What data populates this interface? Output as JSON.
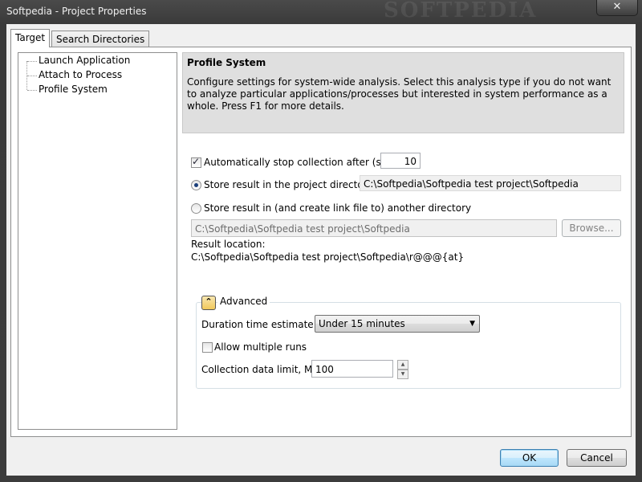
{
  "window": {
    "title": "Softpedia - Project Properties",
    "watermark": "SOFTPEDIA",
    "close_label": "✕"
  },
  "tabs": [
    {
      "label": "Target",
      "active": true
    },
    {
      "label": "Search Directories",
      "active": false
    }
  ],
  "tree": {
    "items": [
      "Launch Application",
      "Attach to Process",
      "Profile System"
    ],
    "selected": "Profile System"
  },
  "panel": {
    "title": "Profile System",
    "description": "Configure settings for system-wide analysis. Select this analysis type if you do not want to analyze particular applications/processes but interested in system performance as a whole. Press F1 for more details."
  },
  "options": {
    "auto_stop_label": "Automatically stop collection after (sec):",
    "auto_stop_checked": true,
    "auto_stop_value": "10",
    "store_project_label": "Store result in the project directory:",
    "store_project_selected": true,
    "project_dir": "C:\\Softpedia\\Softpedia test project\\Softpedia",
    "store_other_label": "Store result in (and create link file to) another directory",
    "store_other_selected": false,
    "other_dir": "C:\\Softpedia\\Softpedia test project\\Softpedia",
    "browse_label": "Browse...",
    "result_location_label": "Result location:",
    "result_location_value": "C:\\Softpedia\\Softpedia test project\\Softpedia\\r@@@{at}"
  },
  "advanced": {
    "title": "Advanced",
    "expander_glyph": "⌃",
    "duration_label": "Duration time estimate:",
    "duration_value": "Under 15 minutes",
    "allow_multiple_label": "Allow multiple runs",
    "allow_multiple_checked": false,
    "data_limit_label": "Collection data limit, MB:",
    "data_limit_value": "100"
  },
  "footer": {
    "ok_label": "OK",
    "cancel_label": "Cancel"
  }
}
